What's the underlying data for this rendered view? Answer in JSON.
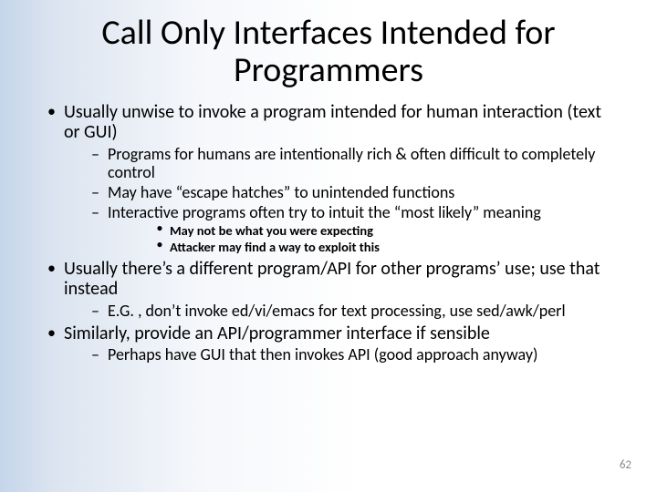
{
  "title": "Call Only Interfaces Intended for Programmers",
  "bullets": {
    "b1": "Usually unwise to invoke a program intended for human interaction (text or GUI)",
    "b1_sub": {
      "s1": "Programs for humans are intentionally rich & often difficult to completely control",
      "s2": "May have “escape hatches” to unintended functions",
      "s3": "Interactive programs often try to intuit the “most likely” meaning",
      "s3_sub": {
        "t1": "May not be what you were expecting",
        "t2": "Attacker may find a way to exploit this"
      }
    },
    "b2": "Usually there’s a different program/API for other programs’ use; use that instead",
    "b2_sub": {
      "s1": "E.G. , don’t invoke ed/vi/emacs for text processing, use sed/awk/perl"
    },
    "b3": "Similarly, provide an API/programmer interface if sensible",
    "b3_sub": {
      "s1": "Perhaps have GUI that then invokes API (good approach anyway)"
    }
  },
  "page_number": "62"
}
